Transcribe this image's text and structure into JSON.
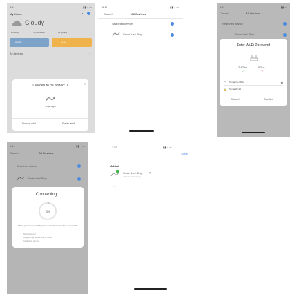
{
  "colors": {
    "accent": "#4a8be0",
    "tile_blue": "#7ea3c9",
    "tile_orange": "#f0b24a",
    "success_green": "#3db64a",
    "progress": "#bfbfbf"
  },
  "screen1": {
    "status_left": "9:41",
    "home_name": "My Home",
    "weather": "Cloudy",
    "weather_stats": [
      "Humidity",
      "Temperature",
      "Air quality"
    ],
    "tiles": [
      "Wi-Fi",
      "Add"
    ],
    "section": "All devices",
    "dialog_title": "Devices to be added: 1",
    "device_caption": "Smart Light",
    "btn_left": "Do not add",
    "btn_right": "Go to add"
  },
  "screen2": {
    "status_left": "9:41",
    "cancel": "Cancel",
    "title": "All Devices",
    "row1": "Searched device",
    "row2": "Smart Led Strip"
  },
  "screen3": {
    "status_left": "9:41",
    "cancel": "Cancel",
    "title": "All Devices",
    "row1": "Searched device",
    "row2": "Smart Led Strip",
    "dialog_title": "Enter Wi-Fi Password",
    "band1": "2.4Ghz",
    "band2": "5Ghz",
    "wifi_name": "Tenga-Inc-Office",
    "password": "Tengai@123",
    "cancel_btn": "Cancel",
    "confirm_btn": "Confirm"
  },
  "screen4": {
    "status_left": "9:41",
    "cancel": "Cancel",
    "title": "All Devices",
    "row1": "Searched device",
    "row2": "Smart Led Strip",
    "dialog_title": "Connecting...",
    "percent": "3%",
    "progress_fraction": 0.03,
    "hint": "Place your router, mobile phone, and device as close as possible",
    "steps": [
      "Device found",
      "Registering device to the cloud",
      "Initializing device"
    ]
  },
  "screen5": {
    "status_left": "7:57",
    "done": "Done",
    "section": "Added",
    "device": "Smart Led Strip",
    "status": "Added successfully"
  }
}
